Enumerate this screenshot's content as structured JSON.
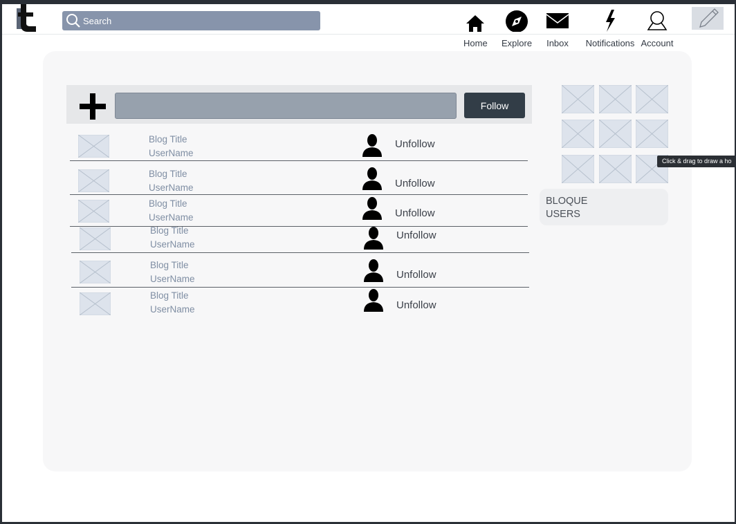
{
  "header": {
    "search_placeholder": "Search",
    "nav": [
      {
        "label": "Home",
        "icon": "home-icon"
      },
      {
        "label": "Explore",
        "icon": "compass-icon"
      },
      {
        "label": "Inbox",
        "icon": "mail-icon"
      },
      {
        "label": "Notifications",
        "icon": "lightning-icon"
      },
      {
        "label": "Account",
        "icon": "user-outline-icon"
      }
    ],
    "compose_icon": "pencil-icon"
  },
  "follow_bar": {
    "add_icon": "plus-icon",
    "follow_label": "Follow"
  },
  "following": [
    {
      "title": "Blog Title",
      "username": "UserName",
      "action": "Unfollow"
    },
    {
      "title": "Blog Title",
      "username": "UserName",
      "action": "Unfollow"
    },
    {
      "title": "Blog Title",
      "username": "UserName",
      "action": "Unfollow"
    },
    {
      "title": "Blog Title",
      "username": "UserName",
      "action": "Unfollow"
    },
    {
      "title": "Blog Title",
      "username": "UserName",
      "action": "Unfollow"
    },
    {
      "title": "Blog Title",
      "username": "UserName",
      "action": "Unfollow"
    }
  ],
  "blocked": {
    "line1": "BLOQUE",
    "line2": "USERS"
  },
  "tooltip": "Click & drag to draw a ho",
  "colors": {
    "search_bg": "#8794ab",
    "follow_button": "#323d47",
    "placeholder_image": "#dde3ec",
    "link_text": "#7f8ea3"
  }
}
